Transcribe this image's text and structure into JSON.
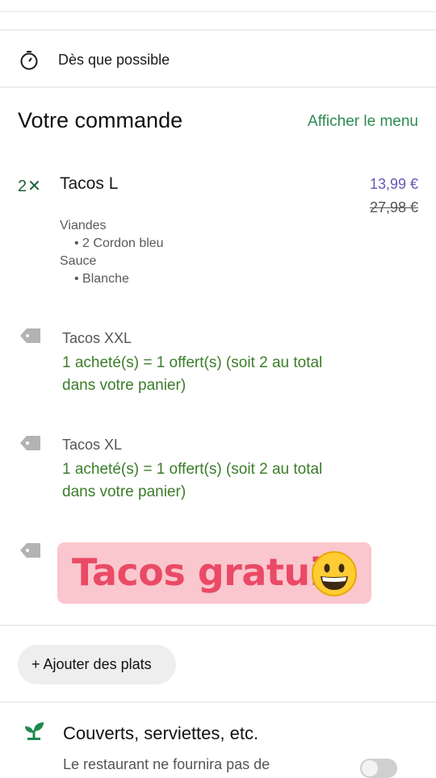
{
  "delivery": {
    "time_label": "Dès que possible",
    "icon": "stopwatch-icon"
  },
  "order": {
    "title": "Votre commande",
    "menu_link": "Afficher le menu",
    "item": {
      "quantity": "2✕",
      "name": "Tacos L",
      "price_new": "13,99 €",
      "price_old": "27,98 €",
      "options": [
        {
          "label": "Viandes",
          "value": "• 2 Cordon bleu"
        },
        {
          "label": "Sauce",
          "value": "• Blanche"
        }
      ]
    },
    "promotions": [
      {
        "name": "Tacos XXL",
        "line1": "1 acheté(s) = 1 offert(s) (soit 2 au total",
        "line2": "dans votre panier)"
      },
      {
        "name": "Tacos XL",
        "line1": "1 acheté(s) = 1 offert(s) (soit 2 au total",
        "line2": "dans votre panier)"
      }
    ]
  },
  "sticker": {
    "text": "Tacos gratuit",
    "emoji": "grinning-face"
  },
  "add_button": {
    "label": "+ Ajouter des plats"
  },
  "cutlery": {
    "title": "Couverts, serviettes, etc.",
    "description": "Le restaurant ne fournira pas de",
    "toggle_on": false
  },
  "colors": {
    "accent_green": "#2e8a53",
    "promo_green": "#3b7d2a",
    "price_purple": "#6a55b8",
    "sticker_bg": "#f9c7cd",
    "sticker_text": "#ea4a66"
  }
}
